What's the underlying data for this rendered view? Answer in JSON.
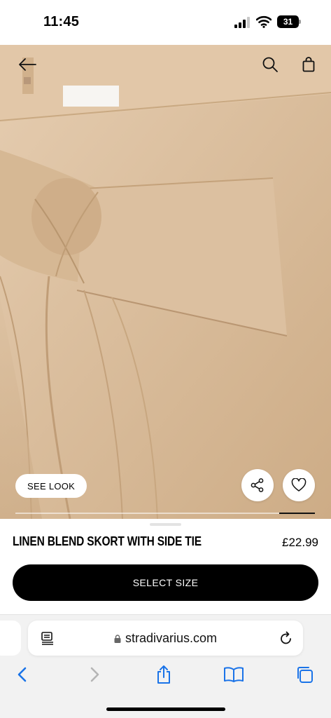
{
  "status_bar": {
    "time": "11:45",
    "battery_level": "31",
    "icons": [
      "signal-icon",
      "wifi-icon",
      "battery-icon"
    ]
  },
  "header": {
    "icons": [
      "back-arrow-icon",
      "search-icon",
      "shopping-bag-icon"
    ]
  },
  "gallery": {
    "see_look_label": "SEE LOOK",
    "actions": [
      "share-icon",
      "heart-icon"
    ],
    "progress": 0.12
  },
  "product": {
    "name": "LINEN BLEND SKORT WITH SIDE TIE",
    "price": "£22.99",
    "select_size_label": "SELECT SIZE"
  },
  "browser": {
    "url": "stradivarius.com",
    "icons": [
      "reader-icon",
      "lock-icon",
      "reload-icon",
      "back-icon",
      "forward-icon",
      "share-icon",
      "bookmarks-icon",
      "tabs-icon"
    ]
  },
  "colors": {
    "fabric": "#d9bc9a",
    "button_bg": "#000000",
    "browser_accent": "#1a73e8"
  }
}
